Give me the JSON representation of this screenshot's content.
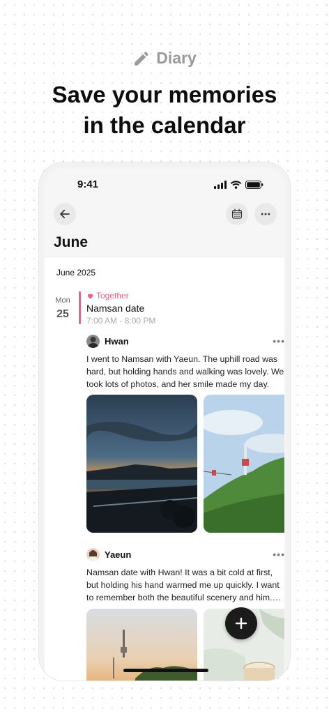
{
  "promo": {
    "tag_icon": "pencil-icon",
    "tag": "Diary",
    "headline_line1": "Save your memories",
    "headline_line2": "in the calendar"
  },
  "status_bar": {
    "time": "9:41",
    "icons": [
      "signal-icon",
      "wifi-icon",
      "battery-icon"
    ]
  },
  "header": {
    "back_icon": "arrow-left-icon",
    "calendar_icon": "calendar-icon",
    "more_icon": "more-horizontal-icon",
    "title": "June"
  },
  "feed": {
    "month_label": "June 2025",
    "day_name": "Mon",
    "day_number": "25",
    "event": {
      "tag_icon": "heart-icon",
      "tag": "Together",
      "title": "Namsan date",
      "time": "7:00 AM - 8:00 PM",
      "accent_color": "#f0607f"
    },
    "entries": [
      {
        "author": "Hwan",
        "text": "I went to Namsan with Yaeun. The uphill road was hard, but holding hands and walking was lovely. We took lots of photos, and her smile made my day.",
        "more": "•••"
      },
      {
        "author": "Yaeun",
        "text": "Namsan date with Hwan! It was a bit cold at first, but holding his hand warmed me up quickly. I want to remember both the beautiful scenery and him. A...",
        "more": "•••"
      }
    ]
  },
  "fab": {
    "icon": "plus-icon",
    "label": "+"
  }
}
